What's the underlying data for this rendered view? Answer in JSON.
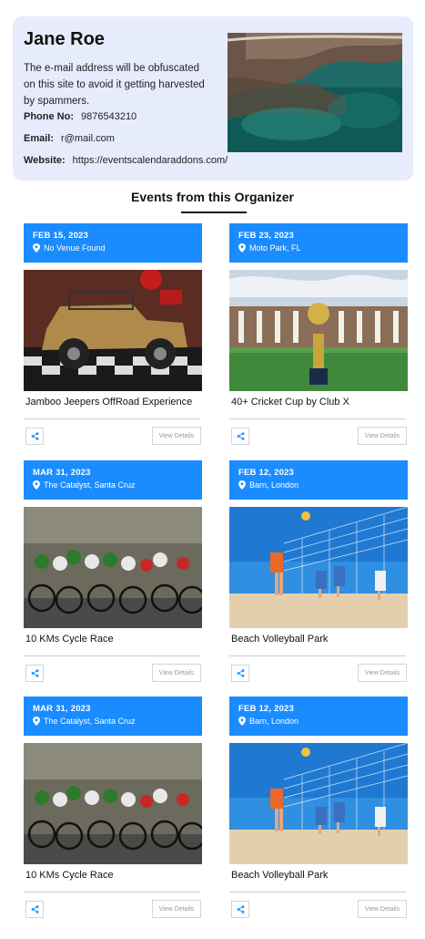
{
  "organizer": {
    "name": "Jane Roe",
    "description": "The e-mail address will be obfuscated on this site to avoid it getting harvested by spammers.",
    "phone_label": "Phone No:",
    "phone": "9876543210",
    "email_label": "Email:",
    "email": "r@mail.com",
    "website_label": "Website:",
    "website": "https://eventscalendaraddons.com/"
  },
  "section": {
    "title": "Events from this Organizer"
  },
  "events": [
    {
      "date": "FEB 15, 2023",
      "venue": "No Venue Found",
      "title": "Jamboo Jeepers OffRoad Experience",
      "view_label": "View Details"
    },
    {
      "date": "FEB 23, 2023",
      "venue": "Moto Park, FL",
      "title": "40+ Cricket Cup by Club X",
      "view_label": "View Details"
    },
    {
      "date": "MAR 31, 2023",
      "venue": "The Catalyst, Santa Cruz",
      "title": "10 KMs Cycle Race",
      "view_label": "View Details"
    },
    {
      "date": "FEB 12, 2023",
      "venue": "Barn, London",
      "title": "Beach Volleyball Park",
      "view_label": "View Details"
    },
    {
      "date": "MAR 31, 2023",
      "venue": "The Catalyst, Santa Cruz",
      "title": "10 KMs Cycle Race",
      "view_label": "View Details"
    },
    {
      "date": "FEB 12, 2023",
      "venue": "Barn, London",
      "title": "Beach Volleyball Park",
      "view_label": "View Details"
    }
  ],
  "colors": {
    "accent": "#1a8cff",
    "card_bg": "#e6ecfb"
  }
}
